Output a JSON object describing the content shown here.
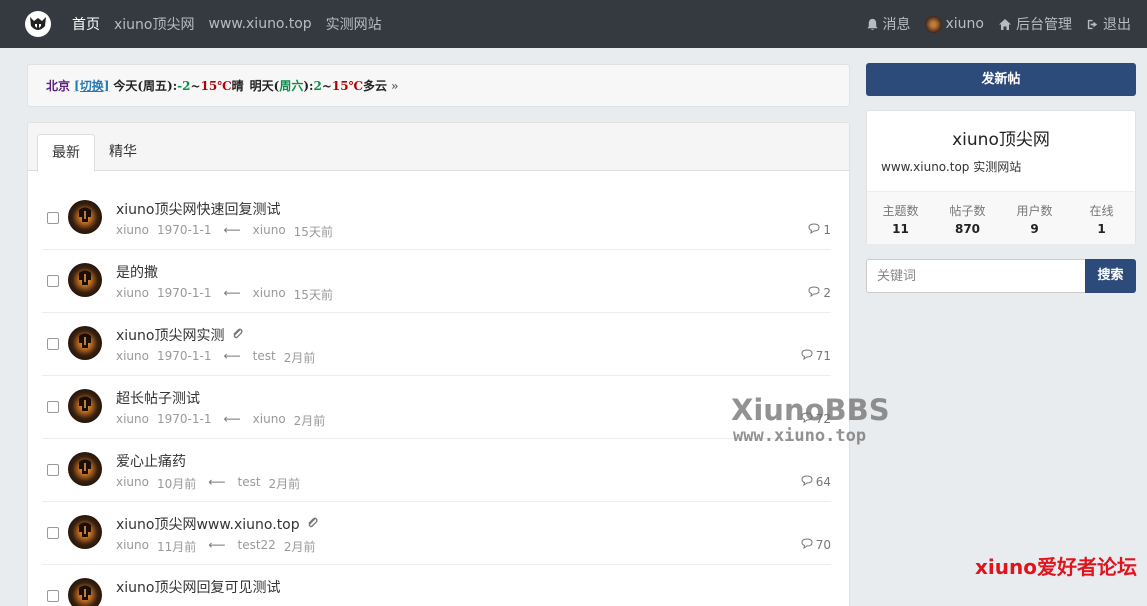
{
  "nav": {
    "items": [
      "首页",
      "xiuno顶尖网",
      "www.xiuno.top",
      "实测网站"
    ],
    "right": {
      "messages": "消息",
      "user": "xiuno",
      "admin": "后台管理",
      "logout": "退出"
    }
  },
  "weather": {
    "city": "北京",
    "switch": "[切换]",
    "today_label": "今天(周五):",
    "today_low": "-2",
    "today_sep": "~",
    "today_high": "15℃",
    "today_cond": "晴",
    "tomorrow_label_a": "明天(",
    "tomorrow_day": "周六",
    "tomorrow_label_b": "):",
    "tomorrow_low": "2",
    "tomorrow_sep": "~",
    "tomorrow_high": "15℃",
    "tomorrow_cond": "多云",
    "more": "»"
  },
  "tabs": [
    "最新",
    "精华"
  ],
  "threads": [
    {
      "subject": "xiuno顶尖网快速回复测试",
      "author": "xiuno",
      "date": "1970-1-1",
      "last_user": "xiuno",
      "last_time": "15天前",
      "replies": "1",
      "attach": false
    },
    {
      "subject": "是的撒",
      "author": "xiuno",
      "date": "1970-1-1",
      "last_user": "xiuno",
      "last_time": "15天前",
      "replies": "2",
      "attach": false
    },
    {
      "subject": "xiuno顶尖网实测",
      "author": "xiuno",
      "date": "1970-1-1",
      "last_user": "test",
      "last_time": "2月前",
      "replies": "71",
      "attach": true
    },
    {
      "subject": "超长帖子测试",
      "author": "xiuno",
      "date": "1970-1-1",
      "last_user": "xiuno",
      "last_time": "2月前",
      "replies": "72",
      "attach": false
    },
    {
      "subject": "爱心止痛药",
      "author": "xiuno",
      "date": "10月前",
      "last_user": "test",
      "last_time": "2月前",
      "replies": "64",
      "attach": false
    },
    {
      "subject": "xiuno顶尖网www.xiuno.top",
      "author": "xiuno",
      "date": "11月前",
      "last_user": "test22",
      "last_time": "2月前",
      "replies": "70",
      "attach": true
    },
    {
      "subject": "xiuno顶尖网回复可见测试",
      "author": "",
      "date": "",
      "last_user": "",
      "last_time": "",
      "replies": "",
      "attach": false
    }
  ],
  "sidebar": {
    "new_thread": "发新帖",
    "site_title": "xiuno顶尖网",
    "site_desc": "www.xiuno.top 实测网站",
    "stats": [
      {
        "label": "主题数",
        "value": "11"
      },
      {
        "label": "帖子数",
        "value": "870"
      },
      {
        "label": "用户数",
        "value": "9"
      },
      {
        "label": "在线",
        "value": "1"
      }
    ],
    "search_placeholder": "关键词",
    "search_button": "搜索"
  },
  "watermarks": {
    "brand": "XiunoBBS",
    "url": "www.xiuno.top",
    "forum": "xiuno爱好者论坛"
  }
}
